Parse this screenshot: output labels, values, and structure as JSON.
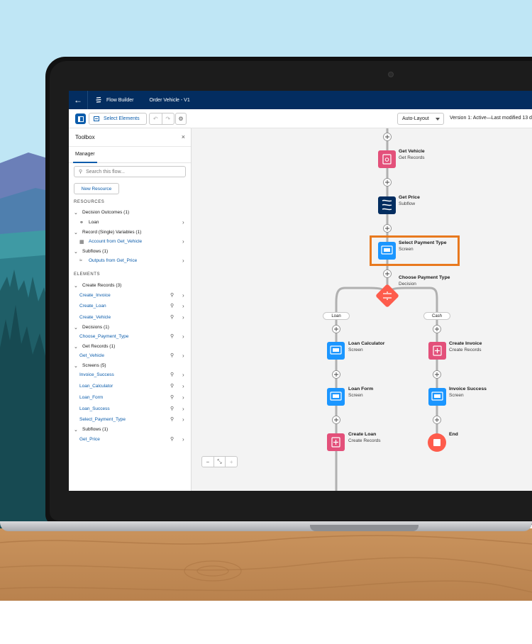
{
  "colors": {
    "navy": "#032d60",
    "brand": "#0b5cab",
    "pink": "#e3507a",
    "blue": "#1b96ff",
    "darkblue": "#032d60",
    "orange": "#fe5c4c",
    "highlight": "#e8791e"
  },
  "topbar": {
    "back_icon": "arrow-left-icon",
    "app_icon": "flow-icon",
    "app_name": "Flow Builder",
    "flow_name": "Order Vehicle - V1"
  },
  "toolbar": {
    "select_elements_label": "Select Elements",
    "undo_icon": "undo-icon",
    "redo_icon": "redo-icon",
    "settings_icon": "gear-icon",
    "layout_selected": "Auto-Layout",
    "version_text": "Version 1: Active—Last modified 13 d"
  },
  "toolbox": {
    "title": "Toolbox",
    "close_glyph": "×",
    "tab": "Manager",
    "search_placeholder": "Search this flow...",
    "new_resource": "New Resource",
    "resources_title": "RESOURCES",
    "elements_title": "ELEMENTS",
    "resources": [
      {
        "category": "Decision Outcomes (1)",
        "items": [
          "Loan"
        ]
      },
      {
        "category": "Record (Single) Variables (1)",
        "items": [
          "Account from Get_Vehicle"
        ]
      },
      {
        "category": "Subflows (1)",
        "items": [
          "Outputs from Get_Price"
        ]
      }
    ],
    "elements": [
      {
        "category": "Create Records (3)",
        "items": [
          "Create_Invoice",
          "Create_Loan",
          "Create_Vehicle"
        ]
      },
      {
        "category": "Decisions (1)",
        "items": [
          "Choose_Payment_Type"
        ]
      },
      {
        "category": "Get Records (1)",
        "items": [
          "Get_Vehicle"
        ]
      },
      {
        "category": "Screens (5)",
        "items": [
          "Invoice_Success",
          "Loan_Calculator",
          "Loan_Form",
          "Loan_Success",
          "Select_Payment_Type"
        ]
      },
      {
        "category": "Subflows (1)",
        "items": [
          "Get_Price"
        ]
      }
    ]
  },
  "flow": {
    "nodes": [
      {
        "label": "Get Vehicle",
        "sub": "Get Records",
        "kind": "get-records"
      },
      {
        "label": "Get Price",
        "sub": "Subflow",
        "kind": "subflow"
      },
      {
        "label": "Select Payment Type",
        "sub": "Screen",
        "kind": "screen"
      },
      {
        "label": "Choose Payment Type",
        "sub": "Decision",
        "kind": "decision"
      },
      {
        "label": "Loan Calculator",
        "sub": "Screen",
        "kind": "screen"
      },
      {
        "label": "Loan Form",
        "sub": "Screen",
        "kind": "screen"
      },
      {
        "label": "Create Loan",
        "sub": "Create Records",
        "kind": "create-records"
      },
      {
        "label": "Create Invoice",
        "sub": "Create Records",
        "kind": "create-records"
      },
      {
        "label": "Invoice Success",
        "sub": "Screen",
        "kind": "screen"
      },
      {
        "label": "End",
        "sub": "",
        "kind": "end"
      }
    ],
    "branches": [
      "Loan",
      "Cash"
    ]
  },
  "zoom": {
    "zoom_out": "−",
    "fit": "⤡",
    "zoom_in": "+"
  }
}
